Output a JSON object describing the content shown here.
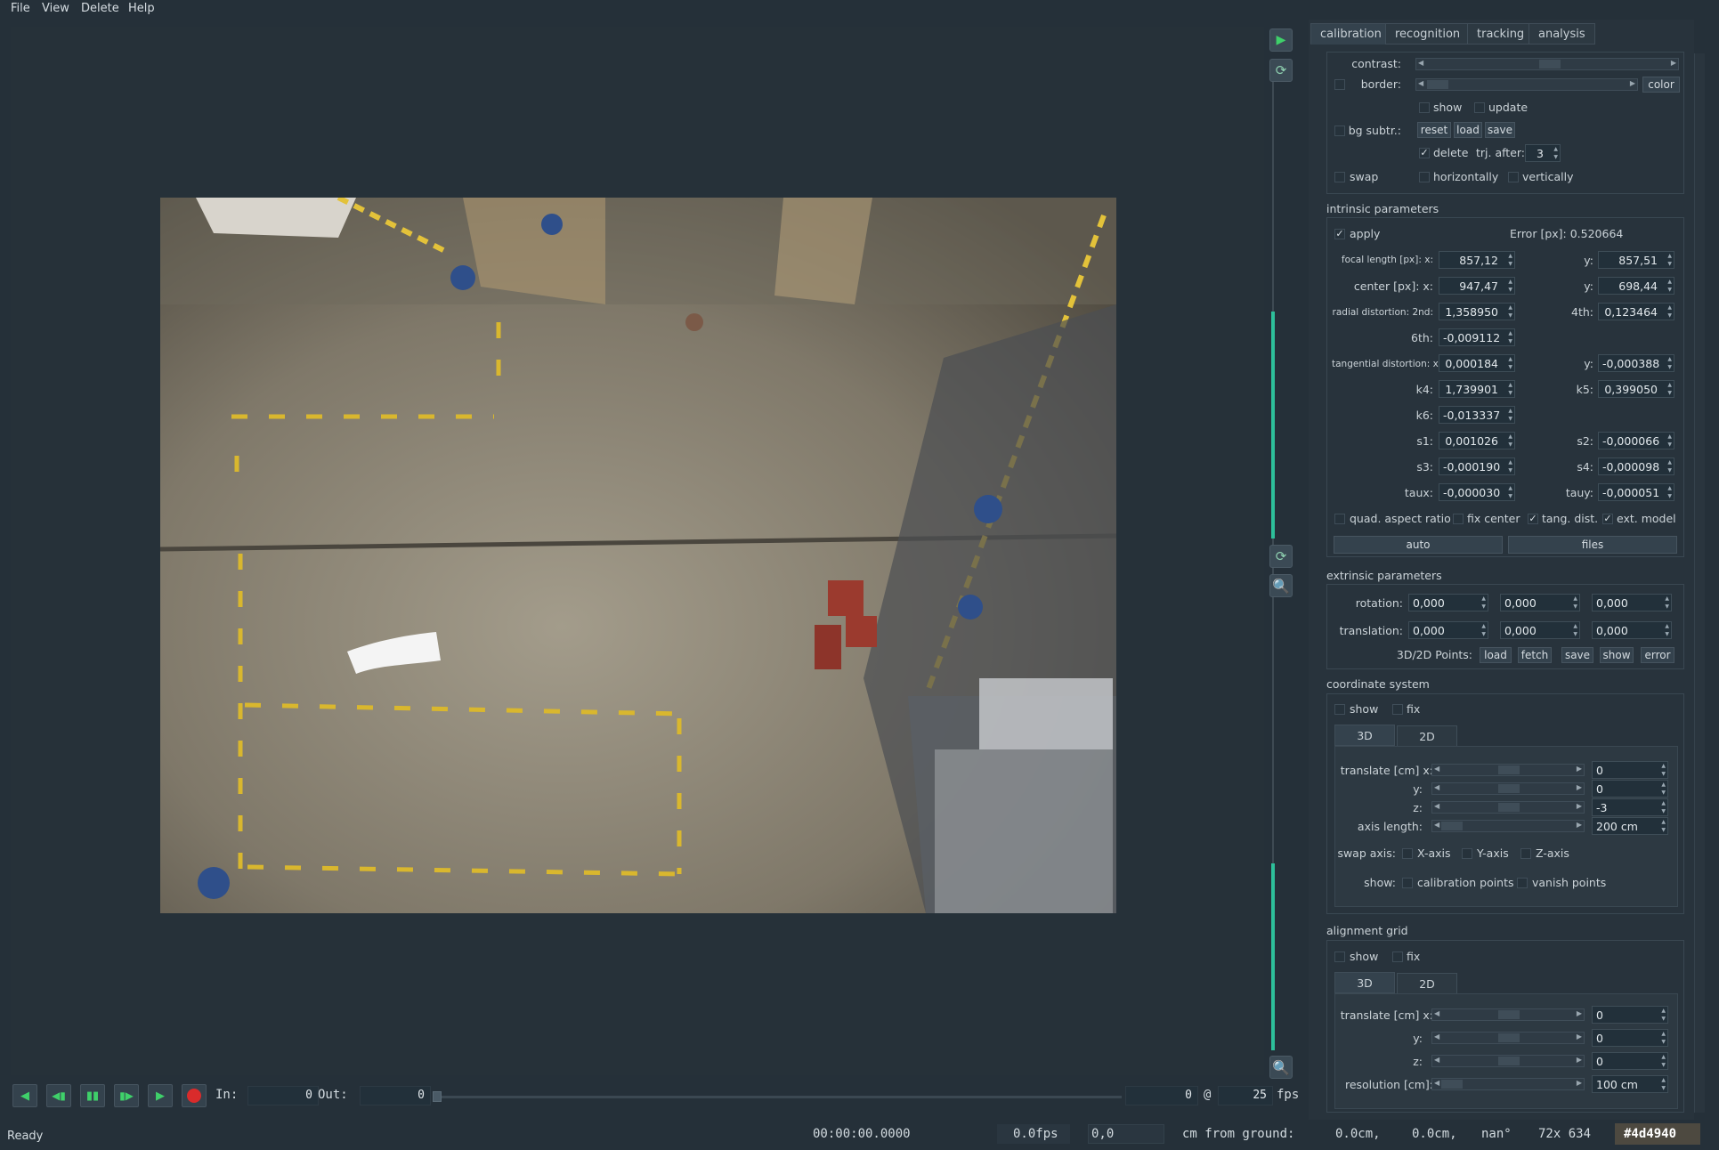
{
  "menu": [
    "File",
    "View",
    "Delete",
    "Help"
  ],
  "tabs": [
    "calibration",
    "recognition",
    "tracking",
    "analysis"
  ],
  "calib": {
    "contrast": "contrast:",
    "border": "border:",
    "color": "color",
    "show": "show",
    "update": "update",
    "bg_subtr": "bg subtr.:",
    "reset": "reset",
    "load": "load",
    "save": "save",
    "delete": "delete",
    "trj_after": "trj. after:",
    "trj_after_val": "3",
    "swap": "swap",
    "horizontally": "horizontally",
    "vertically": "vertically"
  },
  "intrinsic": {
    "title": "intrinsic parameters",
    "apply": "apply",
    "error": "Error [px]: 0.520664",
    "focal_label": "focal length [px]: x:",
    "focal_x": "857,12",
    "focal_y_label": "y:",
    "focal_y": "857,51",
    "center_label": "center [px]: x:",
    "center_x": "947,47",
    "center_y_label": "y:",
    "center_y": "698,44",
    "radial_label": "radial distortion: 2nd:",
    "radial_2nd": "1,358950",
    "fourth_label": "4th:",
    "radial_4th": "0,123464",
    "sixth_label": "6th:",
    "radial_6th": "-0,009112",
    "tang_label": "tangential distortion: x:",
    "tang_x": "0,000184",
    "tang_y_label": "y:",
    "tang_y": "-0,000388",
    "k4_label": "k4:",
    "k4": "1,739901",
    "k5_label": "k5:",
    "k5": "0,399050",
    "k6_label": "k6:",
    "k6": "-0,013337",
    "s1_label": "s1:",
    "s1": "0,001026",
    "s2_label": "s2:",
    "s2": "-0,000066",
    "s3_label": "s3:",
    "s3": "-0,000190",
    "s4_label": "s4:",
    "s4": "-0,000098",
    "taux_label": "taux:",
    "taux": "-0,000030",
    "tauy_label": "tauy:",
    "tauy": "-0,000051",
    "quad": "quad. aspect ratio",
    "fix_center": "fix center",
    "tang_dist": "tang. dist.",
    "ext_model": "ext. model",
    "auto": "auto",
    "files": "files"
  },
  "extrinsic": {
    "title": "extrinsic parameters",
    "rotation_label": "rotation:",
    "rotation": [
      "0,000",
      "0,000",
      "0,000"
    ],
    "translation_label": "translation:",
    "translation": [
      "0,000",
      "0,000",
      "0,000"
    ],
    "points_label": "3D/2D Points:",
    "load": "load",
    "fetch": "fetch",
    "save": "save",
    "show": "show",
    "error": "error"
  },
  "coord": {
    "title": "coordinate system",
    "show": "show",
    "fix": "fix",
    "tab3d": "3D",
    "tab2d": "2D",
    "translate_label": "translate [cm] x:",
    "y_label": "y:",
    "z_label": "z:",
    "tx": "0",
    "ty": "0",
    "tz": "-3",
    "axis_label": "axis length:",
    "axis_val": "200 cm",
    "swap_label": "swap axis:",
    "xaxis": "X-axis",
    "yaxis": "Y-axis",
    "zaxis": "Z-axis",
    "show_label": "show:",
    "calib_points": "calibration points",
    "vanish_points": "vanish points"
  },
  "grid": {
    "title": "alignment grid",
    "show": "show",
    "fix": "fix",
    "tab3d": "3D",
    "tab2d": "2D",
    "translate_label": "translate [cm] x:",
    "y_label": "y:",
    "z_label": "z:",
    "tx": "0",
    "ty": "0",
    "tz": "0",
    "res_label": "resolution [cm]:",
    "res_val": "100 cm"
  },
  "transport": {
    "in_label": "In:",
    "in_val": "0",
    "out_label": "Out:",
    "out_val": "0",
    "frame": "0",
    "at": "@",
    "fps_val": "25",
    "fps_label": "fps"
  },
  "status": {
    "ready": "Ready",
    "time": "00:00:00.0000",
    "fps": "0.0fps",
    "pos": "0,0",
    "ground_label": "cm from ground:",
    "x": "0.0cm,",
    "y": "0.0cm,",
    "angle": "nan°",
    "pixel": "72x 634",
    "color_hex": "#4d4940"
  },
  "colors": {
    "background": "#253039",
    "accent": "#2dbf9a",
    "pixel_color": "#4d4940"
  },
  "icons": [
    "play-icon",
    "refresh-icon",
    "zoom-icon",
    "record-icon"
  ]
}
